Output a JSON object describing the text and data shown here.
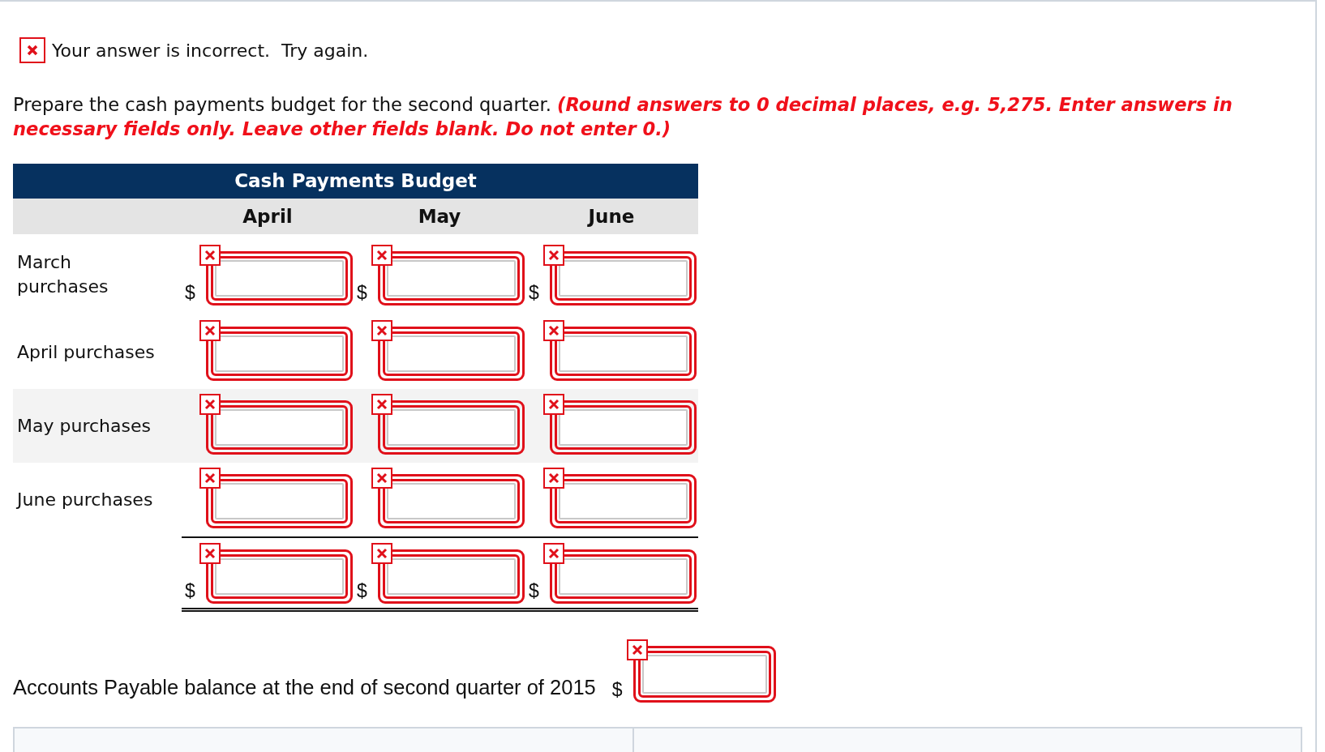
{
  "feedback": {
    "incorrect": true,
    "message": "Your answer is incorrect.  Try again."
  },
  "instructions": {
    "text": "Prepare the cash payments budget for the second quarter.",
    "note": "(Round answers to 0 decimal places, e.g. 5,275. Enter answers in necessary fields only. Leave other fields blank. Do not enter 0.)"
  },
  "table": {
    "title": "Cash Payments Budget",
    "columns": [
      "April",
      "May",
      "June"
    ],
    "rows": [
      {
        "label": "March purchases",
        "shaded": false,
        "kind": "item",
        "cells": [
          {
            "currency": "$",
            "incorrect": true
          },
          {
            "currency": "$",
            "incorrect": true
          },
          {
            "currency": "$",
            "incorrect": true
          }
        ]
      },
      {
        "label": "April purchases",
        "shaded": false,
        "kind": "item",
        "cells": [
          {
            "incorrect": true
          },
          {
            "incorrect": true
          },
          {
            "incorrect": true
          }
        ]
      },
      {
        "label": "May purchases",
        "shaded": true,
        "kind": "item",
        "cells": [
          {
            "incorrect": true
          },
          {
            "incorrect": true
          },
          {
            "incorrect": true
          }
        ]
      },
      {
        "label": "June purchases",
        "shaded": false,
        "kind": "item",
        "cells": [
          {
            "incorrect": true
          },
          {
            "incorrect": true
          },
          {
            "incorrect": true
          }
        ]
      },
      {
        "shaded": false,
        "kind": "total",
        "cells": [
          {
            "currency": "$",
            "incorrect": true
          },
          {
            "currency": "$",
            "incorrect": true
          },
          {
            "currency": "$",
            "incorrect": true
          }
        ]
      }
    ]
  },
  "accounts_payable": {
    "label": "Accounts Payable balance at the end of second quarter of 2015",
    "currency": "$",
    "incorrect": true
  }
}
